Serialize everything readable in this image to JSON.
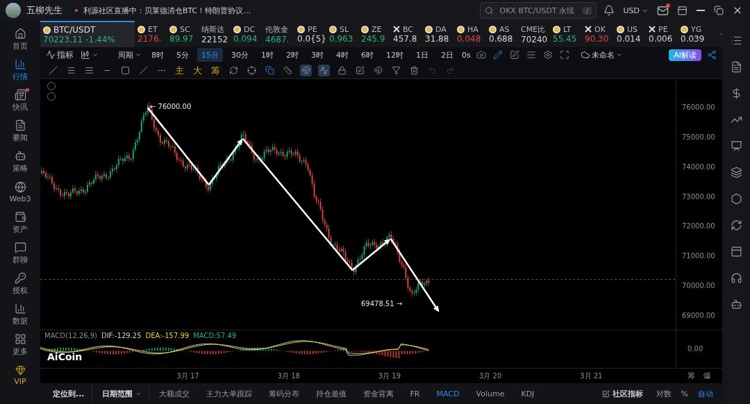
{
  "title_bar": {
    "user": "五柳先生",
    "news": "利源社区直播中：贝莱德清仓BTC！特朗普协议…",
    "search": {
      "placeholder": "OKX BTC/USDT 永续",
      "shortcut": "/"
    },
    "currency": "USD",
    "mail_unread": true
  },
  "sidebar": {
    "items": [
      {
        "label": "首页",
        "selected": false,
        "badge": false
      },
      {
        "label": "行情",
        "selected": true,
        "badge": false
      },
      {
        "label": "快讯",
        "selected": false,
        "badge": true
      },
      {
        "label": "要闻",
        "selected": false,
        "badge": false
      },
      {
        "label": "策略",
        "selected": false,
        "badge": false
      },
      {
        "label": "Web3",
        "selected": false,
        "badge": false
      },
      {
        "label": "资产",
        "selected": false,
        "badge": false
      },
      {
        "label": "群聊",
        "selected": false,
        "badge": false
      },
      {
        "label": "授权",
        "selected": false,
        "badge": false
      },
      {
        "label": "数据",
        "selected": false,
        "badge": false
      },
      {
        "label": "更多",
        "selected": false,
        "badge": false
      }
    ],
    "vip": "VIP"
  },
  "tickers": [
    {
      "symbol": "BTC/USDT",
      "price": "70223.11",
      "change": "-1.44%",
      "selected": true,
      "color": "#2fb37c",
      "kind": "coin"
    },
    {
      "symbol": "ET",
      "price": "2176.",
      "selected": false,
      "color": "#e0494b",
      "kind": "coin"
    },
    {
      "symbol": "SC",
      "price": "89.97",
      "selected": false,
      "color": "#2fb37c",
      "kind": "coin"
    },
    {
      "symbol": "纳斯达",
      "price": "22152",
      "selected": false,
      "color": "#d8d9dc",
      "kind": "index"
    },
    {
      "symbol": "DC",
      "price": "0.094",
      "selected": false,
      "color": "#2fb37c",
      "kind": "coin"
    },
    {
      "symbol": "伦敦金",
      "price": "4687.",
      "selected": false,
      "color": "#2fb37c",
      "kind": "index"
    },
    {
      "symbol": "PE",
      "price": "0.0{5}",
      "selected": false,
      "color": "#d8d9dc",
      "kind": "coin"
    },
    {
      "symbol": "SL",
      "price": "0.963",
      "selected": false,
      "color": "#2fb37c",
      "kind": "coin"
    },
    {
      "symbol": "ZE",
      "price": "245.9",
      "selected": false,
      "color": "#2fb37c",
      "kind": "coin"
    },
    {
      "symbol": "BC",
      "price": "457.8",
      "selected": false,
      "color": "#d8d9dc",
      "kind": "token"
    },
    {
      "symbol": "DA",
      "price": "31.88",
      "selected": false,
      "color": "#d8d9dc",
      "kind": "coin"
    },
    {
      "symbol": "HA",
      "price": "0.048",
      "selected": false,
      "color": "#e0494b",
      "kind": "coin"
    },
    {
      "symbol": "AS",
      "price": "0.688",
      "selected": false,
      "color": "#d8d9dc",
      "kind": "coin"
    },
    {
      "symbol": "CME比",
      "price": "70240",
      "selected": false,
      "color": "#d8d9dc",
      "kind": "index"
    },
    {
      "symbol": "LT",
      "price": "55.45",
      "selected": false,
      "color": "#2fb37c",
      "kind": "coin"
    },
    {
      "symbol": "OK",
      "price": "90.30",
      "selected": false,
      "color": "#e0494b",
      "kind": "token"
    },
    {
      "symbol": "US",
      "price": "0.014",
      "selected": false,
      "color": "#d8d9dc",
      "kind": "coin"
    },
    {
      "symbol": "PE",
      "price": "0.006",
      "selected": false,
      "color": "#d8d9dc",
      "kind": "token"
    },
    {
      "symbol": "YG",
      "price": "0.039",
      "selected": false,
      "color": "#d8d9dc",
      "kind": "coin"
    }
  ],
  "toolbar": {
    "indicators": "指标",
    "period": "周期",
    "intervals": [
      {
        "label": "8时",
        "selected": false
      },
      {
        "label": "5分",
        "selected": false
      },
      {
        "label": "15分",
        "selected": true
      },
      {
        "label": "30分",
        "selected": false
      },
      {
        "label": "1时",
        "selected": false
      },
      {
        "label": "2时",
        "selected": false
      },
      {
        "label": "3时",
        "selected": false
      },
      {
        "label": "4时",
        "selected": false
      },
      {
        "label": "6时",
        "selected": false
      },
      {
        "label": "12时",
        "selected": false
      },
      {
        "label": "1日",
        "selected": false
      },
      {
        "label": "2日",
        "selected": false
      }
    ],
    "countdown": "0s",
    "layout_name": "未命名",
    "ai_button": "AI解读"
  },
  "drawing_toolbar": {
    "text_tools": [
      "主",
      "大",
      "筹"
    ]
  },
  "chart": {
    "price_labels": [
      "76000.00",
      "75000.00",
      "74000.00",
      "73000.00",
      "72000.00",
      "71000.00",
      "70000.00",
      "69000.00"
    ],
    "high_label": "← 76000.00",
    "low_label": "69478.51 →",
    "logo": "AiCoin"
  },
  "macd": {
    "label": "MACD(12,26,9)",
    "dif": "DIF:-129.25",
    "dea": "DEA:-157.99",
    "macd": "MACD:57.49",
    "zero": "0.00"
  },
  "dates": [
    "3月 17",
    "3月 18",
    "3月 19",
    "3月 20",
    "3月 21"
  ],
  "axis_corner": [
    "筹",
    "爆"
  ],
  "bottom_bar": {
    "locate": "定位到...",
    "date_range": "日期范围",
    "tabs": [
      {
        "label": "大额成交",
        "selected": false
      },
      {
        "label": "主力大单跟踪",
        "selected": false
      },
      {
        "label": "筹码分布",
        "selected": false
      },
      {
        "label": "持仓差值",
        "selected": false
      },
      {
        "label": "资金背离",
        "selected": false
      },
      {
        "label": "FR",
        "selected": false
      },
      {
        "label": "MACD",
        "selected": true
      },
      {
        "label": "Volume",
        "selected": false
      },
      {
        "label": "KDJ",
        "selected": false
      }
    ],
    "community": "社区指标",
    "options": [
      {
        "label": "对数",
        "selected": false
      },
      {
        "label": "%",
        "selected": false
      },
      {
        "label": "自动",
        "selected": true
      }
    ]
  }
}
